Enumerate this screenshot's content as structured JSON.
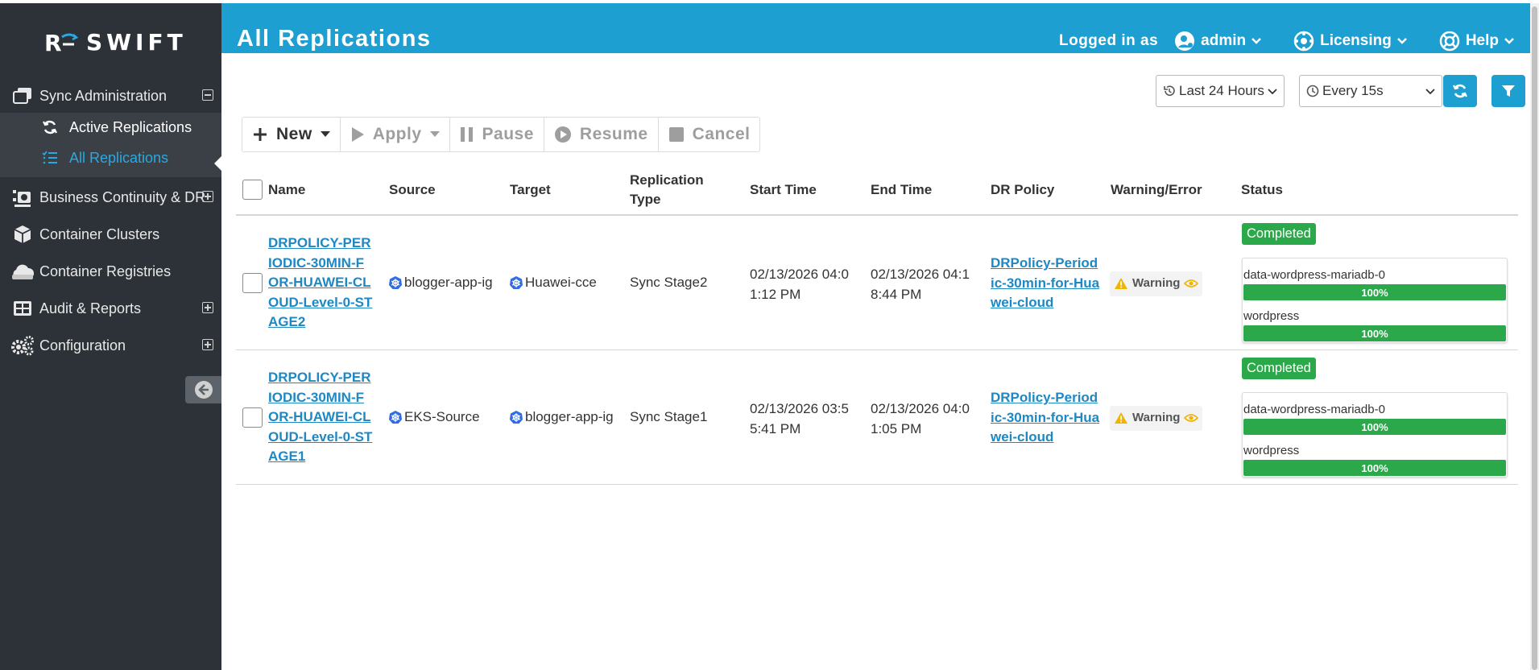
{
  "app": {
    "brand": "SWIFT"
  },
  "colors": {
    "accent": "#1e9fd1",
    "sidebar": "#2c3237",
    "success": "#2aa84a",
    "warning": "#f0b400",
    "link": "#1e88c4"
  },
  "sidebar": {
    "items": [
      {
        "label": "Sync Administration",
        "icon": "windows-icon",
        "expanded": true
      },
      {
        "label": "Business Continuity & DR",
        "icon": "dr-icon"
      },
      {
        "label": "Container Clusters",
        "icon": "cube-icon"
      },
      {
        "label": "Container Registries",
        "icon": "cloud-icon"
      },
      {
        "label": "Audit & Reports",
        "icon": "grid-icon"
      },
      {
        "label": "Configuration",
        "icon": "gears-icon"
      }
    ],
    "sub_items": [
      {
        "label": "Active Replications",
        "icon": "sync-icon"
      },
      {
        "label": "All Replications",
        "icon": "list-icon",
        "active": true
      }
    ]
  },
  "header": {
    "title": "All Replications",
    "logged_in_as": "Logged in as",
    "user": "admin",
    "licensing": "Licensing",
    "help": "Help"
  },
  "filters": {
    "range": "Last 24 Hours",
    "refresh": "Every 15s"
  },
  "toolbar": {
    "new": "New",
    "apply": "Apply",
    "pause": "Pause",
    "resume": "Resume",
    "cancel": "Cancel"
  },
  "table": {
    "columns": {
      "name": "Name",
      "source": "Source",
      "target": "Target",
      "type": "Replication Type",
      "start": "Start Time",
      "end": "End Time",
      "policy": "DR Policy",
      "warning": "Warning/Error",
      "status": "Status"
    },
    "rows": [
      {
        "name": "DRPOLICY-PERIODIC-30MIN-FOR-HUAWEI-CLOUD-Level-0-STAGE2",
        "source": "blogger-app-ig",
        "target": "Huawei-cce",
        "type": "Sync Stage2",
        "start": "02/13/2026 04:01:12 PM",
        "end": "02/13/2026 04:18:44 PM",
        "policy": "DRPolicy-Periodic-30min-for-Huawei-cloud",
        "warning": "Warning",
        "status": "Completed",
        "volumes": [
          {
            "name": "data-wordpress-mariadb-0",
            "progress": "100%",
            "fraction": 1
          },
          {
            "name": "wordpress",
            "progress": "100%",
            "fraction": 1
          }
        ]
      },
      {
        "name": "DRPOLICY-PERIODIC-30MIN-FOR-HUAWEI-CLOUD-Level-0-STAGE1",
        "source": "EKS-Source",
        "target": "blogger-app-ig",
        "type": "Sync Stage1",
        "start": "02/13/2026 03:55:41 PM",
        "end": "02/13/2026 04:01:05 PM",
        "policy": "DRPolicy-Periodic-30min-for-Huawei-cloud",
        "warning": "Warning",
        "status": "Completed",
        "volumes": [
          {
            "name": "data-wordpress-mariadb-0",
            "progress": "100%",
            "fraction": 1
          },
          {
            "name": "wordpress",
            "progress": "100%",
            "fraction": 1
          }
        ]
      }
    ]
  }
}
